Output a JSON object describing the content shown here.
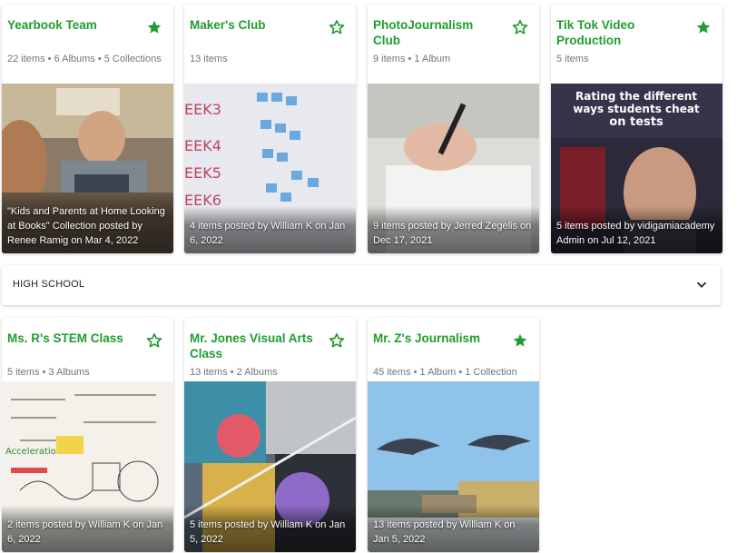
{
  "colors": {
    "accent": "#1f9d2e",
    "meta": "#757575"
  },
  "top_row": [
    {
      "title": "Yearbook Team",
      "meta": "22 items • 6 Albums • 5 Collections",
      "starred": true,
      "caption": "\"Kids and Parents at Home Looking at Books\" Collection posted by Renee Ramig on Mar 4, 2022"
    },
    {
      "title": "Maker's Club",
      "meta": "13 items",
      "starred": false,
      "caption": "4 items posted by William K on Jan 6, 2022"
    },
    {
      "title": "PhotoJournalism Club",
      "meta": "9 items • 1 Album",
      "starred": false,
      "caption": "9 items posted by Jerred Zegelis on Dec 17, 2021"
    },
    {
      "title": "Tik Tok Video Production",
      "meta": "5 items",
      "starred": true,
      "caption": "5 items posted by vidigamiacademy Admin on Jul 12, 2021",
      "thumb_text": [
        "Rating the different",
        "ways students cheat",
        "on tests"
      ]
    }
  ],
  "section": {
    "label": "HIGH SCHOOL",
    "icon": "chevron-down-icon"
  },
  "bottom_row": [
    {
      "title": "Ms. R's STEM Class",
      "meta": "5 items • 3 Albums",
      "starred": false,
      "caption": "2 items posted by William K on Jan 6, 2022"
    },
    {
      "title": "Mr. Jones Visual Arts Class",
      "meta": "13 items • 2 Albums",
      "starred": false,
      "caption": "5 items posted by William K on Jan 5, 2022"
    },
    {
      "title": "Mr. Z's Journalism",
      "meta": "45 items • 1 Album • 1 Collection",
      "starred": true,
      "caption": "13 items posted by William K on Jan 5, 2022"
    }
  ]
}
